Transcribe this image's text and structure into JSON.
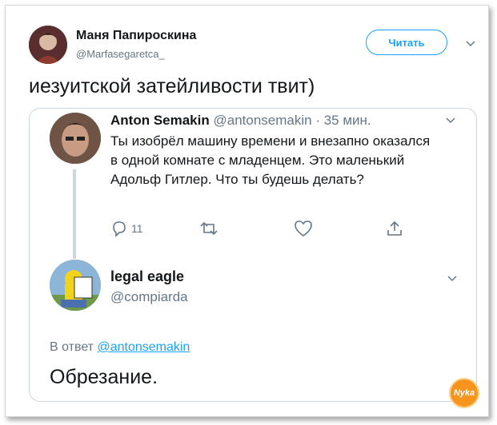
{
  "author": {
    "name": "Маня Папироскина",
    "handle": "@Marfasegaretca_",
    "follow_label": "Читать"
  },
  "tweet": {
    "text": "иезуитской затейливости твит)"
  },
  "quoted_thread": {
    "first": {
      "name": "Anton Semakin",
      "handle": "@antonsemakin",
      "time": "· 35 мин.",
      "body": "Ты изобрёл машину времени и внезапно оказался в одной комнате с младенцем. Это маленький Адольф Гитлер. Что ты будешь делать?",
      "reply_count": "11"
    },
    "second": {
      "name": "legal eagle",
      "handle": "@compiarda",
      "reply_prefix": "В ответ",
      "reply_to": "@antonsemakin",
      "body": "Обрезание."
    }
  },
  "icons": [
    "chevron-down-icon",
    "reply-icon",
    "retweet-icon",
    "like-icon",
    "share-icon"
  ],
  "colors": {
    "accent": "#1da1f2",
    "muted": "#657786",
    "border": "#ccd6dd",
    "watermark": "#f7941d"
  },
  "watermark_text": "Nyka"
}
